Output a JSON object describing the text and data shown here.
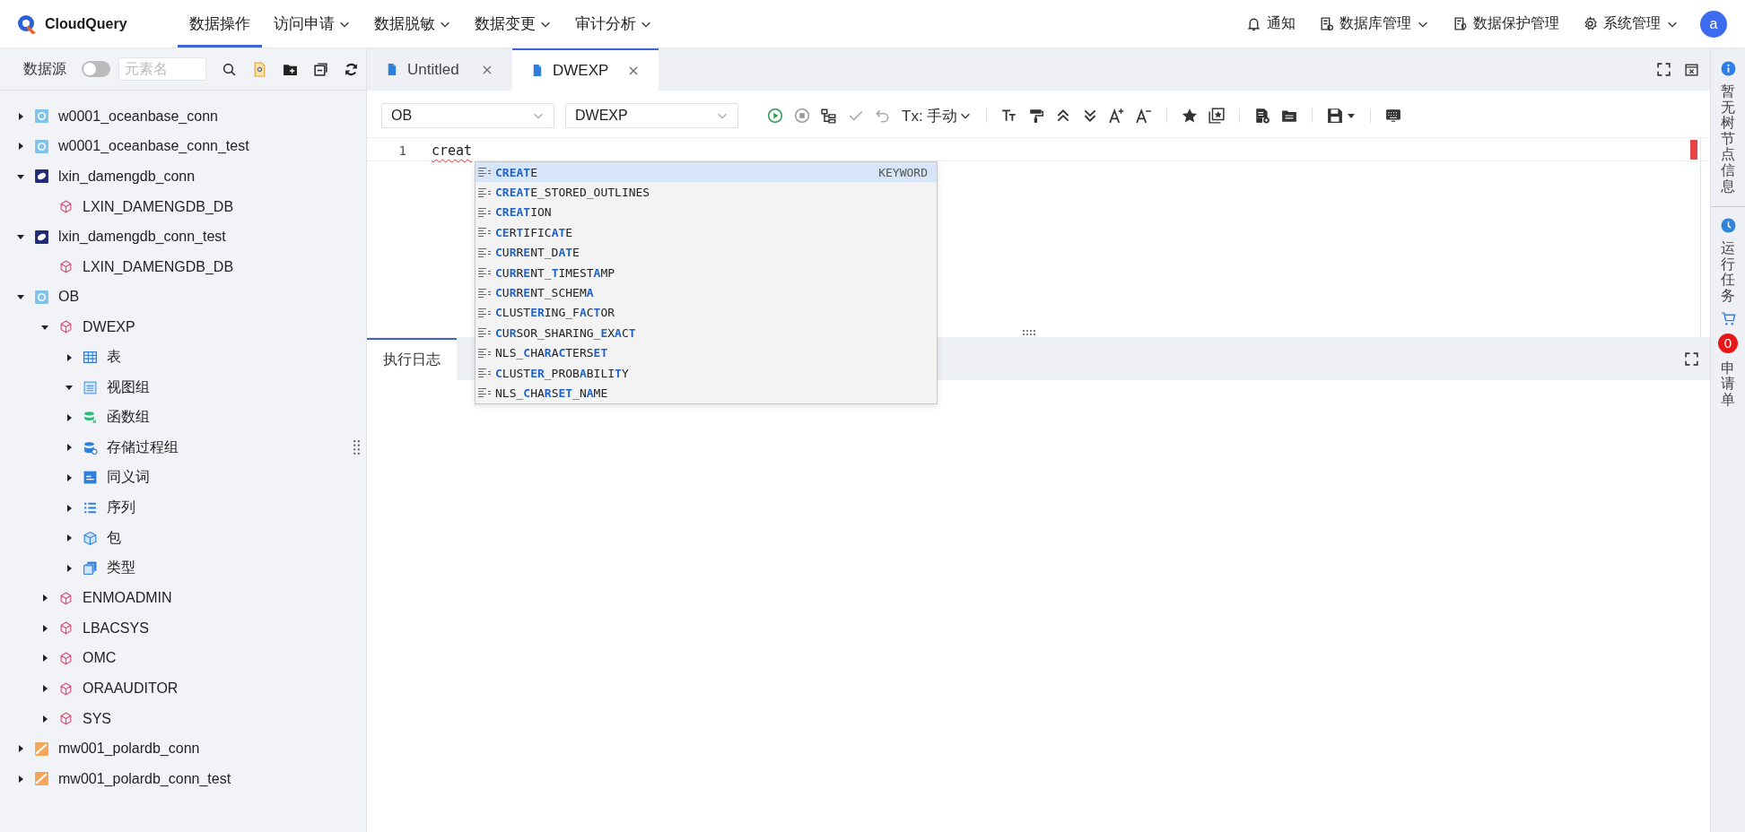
{
  "nav": {
    "brand": "CloudQuery",
    "menu": [
      {
        "label": "数据操作",
        "selected": true,
        "dropdown": false
      },
      {
        "label": "访问申请",
        "selected": false,
        "dropdown": true
      },
      {
        "label": "数据脱敏",
        "selected": false,
        "dropdown": true
      },
      {
        "label": "数据变更",
        "selected": false,
        "dropdown": true
      },
      {
        "label": "审计分析",
        "selected": false,
        "dropdown": true
      }
    ],
    "actions": [
      {
        "kind": "bell",
        "label": "通知",
        "dropdown": false
      },
      {
        "kind": "db",
        "label": "数据库管理",
        "dropdown": true
      },
      {
        "kind": "shield",
        "label": "数据保护管理",
        "dropdown": false
      },
      {
        "kind": "gear",
        "label": "系统管理",
        "dropdown": true
      }
    ],
    "avatar": "a"
  },
  "sidebar": {
    "title": "数据源",
    "toggle": {
      "on": false
    },
    "search": {
      "placeholder": "元素名"
    },
    "tree": [
      {
        "kind": "oceanbase",
        "label": "w0001_oceanbase_conn",
        "expanded": false
      },
      {
        "kind": "oceanbase",
        "label": "w0001_oceanbase_conn_test",
        "expanded": false
      },
      {
        "kind": "dameng",
        "label": "lxin_damengdb_conn",
        "expanded": true,
        "children": [
          {
            "kind": "schema",
            "label": "LXIN_DAMENGDB_DB"
          }
        ]
      },
      {
        "kind": "dameng",
        "label": "lxin_damengdb_conn_test",
        "expanded": true,
        "children": [
          {
            "kind": "schema",
            "label": "LXIN_DAMENGDB_DB"
          }
        ]
      },
      {
        "kind": "oceanbase",
        "label": "OB",
        "expanded": true,
        "children": [
          {
            "kind": "schema",
            "label": "DWEXP",
            "expanded": true,
            "children": [
              {
                "kind": "table",
                "label": "表",
                "expanded": false
              },
              {
                "kind": "view",
                "label": "视图组",
                "expanded": true
              },
              {
                "kind": "function",
                "label": "函数组",
                "expanded": false
              },
              {
                "kind": "procedure",
                "label": "存储过程组",
                "expanded": false
              },
              {
                "kind": "synonym",
                "label": "同义词",
                "expanded": false
              },
              {
                "kind": "sequence",
                "label": "序列",
                "expanded": false
              },
              {
                "kind": "package",
                "label": "包",
                "expanded": false
              },
              {
                "kind": "type",
                "label": "类型",
                "expanded": false
              }
            ]
          },
          {
            "kind": "schema",
            "label": "ENMOADMIN",
            "expanded": false
          },
          {
            "kind": "schema",
            "label": "LBACSYS",
            "expanded": false
          },
          {
            "kind": "schema",
            "label": "OMC",
            "expanded": false
          },
          {
            "kind": "schema",
            "label": "ORAAUDITOR",
            "expanded": false
          },
          {
            "kind": "schema",
            "label": "SYS",
            "expanded": false
          }
        ]
      },
      {
        "kind": "polardb",
        "label": "mw001_polardb_conn",
        "expanded": false
      },
      {
        "kind": "polardb",
        "label": "mw001_polardb_conn_test",
        "expanded": false
      }
    ]
  },
  "tabs": [
    {
      "label": "Untitled",
      "selected": false
    },
    {
      "label": "DWEXP",
      "selected": true
    }
  ],
  "toolbar": {
    "connection": "OB",
    "schema": "DWEXP",
    "tx_mode": "Tx: 手动"
  },
  "editor": {
    "lines": [
      {
        "number": "1",
        "text": "creat"
      }
    ],
    "autocomplete": [
      {
        "text": "**CREAT**E",
        "detail": "KEYWORD",
        "selected": true
      },
      {
        "text": "**CREAT**E_STORED_OUTLINES",
        "selected": false
      },
      {
        "text": "**CREAT**ION",
        "selected": false
      },
      {
        "text": "**CE**R**T**IFIC**AT**E",
        "selected": false
      },
      {
        "text": "**C**U**R**R**E**NT_D**AT**E",
        "selected": false
      },
      {
        "text": "**C**U**R**R**E**NT_**T**IMEST**A**MP",
        "selected": false
      },
      {
        "text": "**C**U**R**R**E**NT_SCHEM**A**",
        "selected": false
      },
      {
        "text": "**C**LUST**ER**ING_F**A**C**T**OR",
        "selected": false
      },
      {
        "text": "**C**U**R**SOR_SHARING_**E**X**A**C**T**",
        "selected": false
      },
      {
        "text": "NLS_**C**HA**R**A**C**TERS**ET**",
        "selected": false
      },
      {
        "text": "**C**LUST**ER**_PROB**A**BILI**T**Y",
        "selected": false
      },
      {
        "text": "NLS_**C**HA**R**S**ET**_N**A**ME",
        "selected": false
      }
    ]
  },
  "results": {
    "tabs": [
      {
        "label": "执行日志",
        "selected": true
      }
    ]
  },
  "right_rail": [
    {
      "kind": "info",
      "label": "暂无树节点信息"
    },
    {
      "kind": "clock",
      "label": "运行任务"
    },
    {
      "kind": "cart",
      "badge": "0",
      "label": "申请单"
    }
  ]
}
